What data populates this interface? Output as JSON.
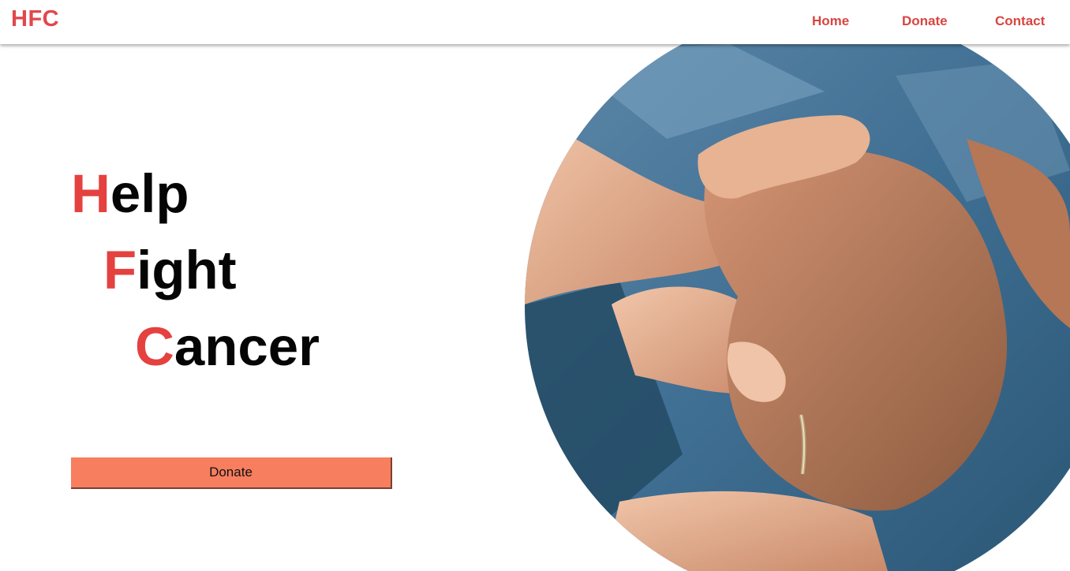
{
  "nav": {
    "logo": "HFC",
    "links": [
      "Home",
      "Donate",
      "Contact"
    ]
  },
  "hero": {
    "lines": [
      {
        "first": "H",
        "rest": "elp"
      },
      {
        "first": "F",
        "rest": "ight"
      },
      {
        "first": "C",
        "rest": "ancer"
      }
    ],
    "donate_label": "Donate",
    "image_alt": "hands-holding-photo"
  },
  "colors": {
    "accent": "#e2474c",
    "button": "#f77e5f",
    "text": "#050505"
  }
}
